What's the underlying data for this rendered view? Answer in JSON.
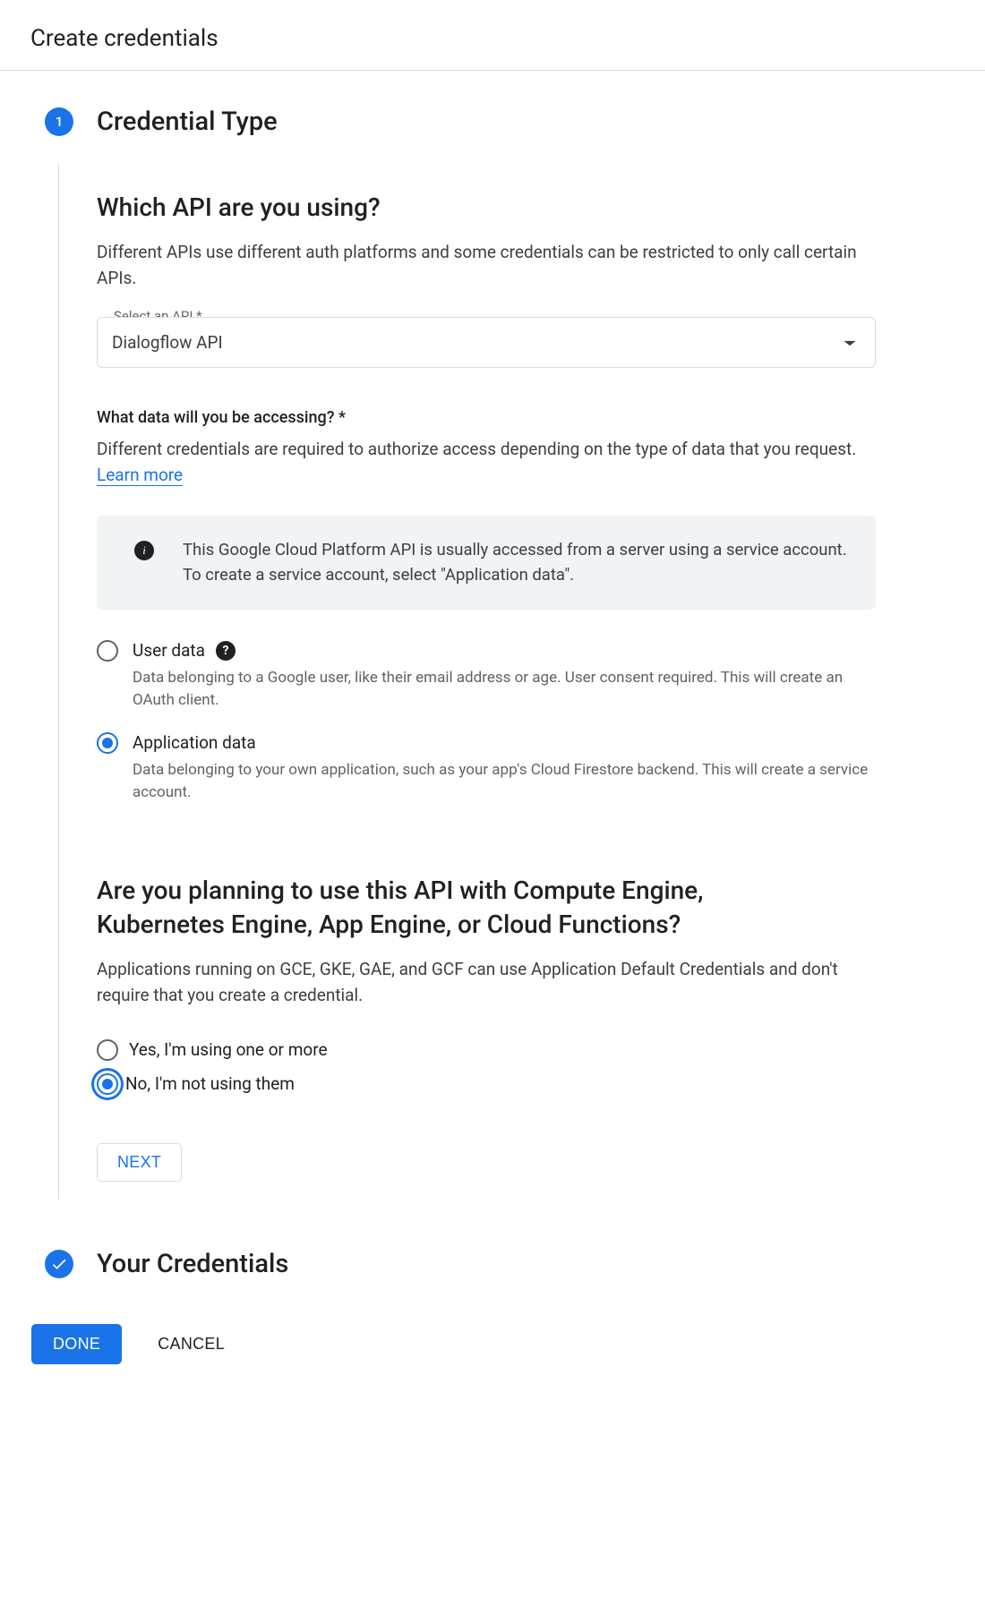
{
  "header": {
    "title": "Create credentials"
  },
  "step1": {
    "number": "1",
    "title": "Credential Type",
    "q1": {
      "heading": "Which API are you using?",
      "sub": "Different APIs use different auth platforms and some credentials can be restricted to only call certain APIs.",
      "select_label": "Select an API *",
      "select_value": "Dialogflow API"
    },
    "q2": {
      "label": "What data will you be accessing? *",
      "sub_prefix": "Different credentials are required to authorize access depending on the type of data that you request. ",
      "learn_more": "Learn more",
      "info": "This Google Cloud Platform API is usually accessed from a server using a service account. To create a service account, select \"Application data\".",
      "options": [
        {
          "title": "User data",
          "desc": "Data belonging to a Google user, like their email address or age. User consent required. This will create an OAuth client.",
          "checked": false,
          "help": true
        },
        {
          "title": "Application data",
          "desc": "Data belonging to your own application, such as your app's Cloud Firestore backend. This will create a service account.",
          "checked": true,
          "help": false
        }
      ]
    },
    "q3": {
      "heading": "Are you planning to use this API with Compute Engine, Kubernetes Engine, App Engine, or Cloud Functions?",
      "sub": "Applications running on GCE, GKE, GAE, and GCF can use Application Default Credentials and don't require that you create a credential.",
      "options": [
        {
          "label": "Yes, I'm using one or more",
          "checked": false
        },
        {
          "label": "No, I'm not using them",
          "checked": true,
          "focus_ring": true
        }
      ]
    },
    "next_label": "NEXT"
  },
  "step2": {
    "title": "Your Credentials"
  },
  "actions": {
    "done": "DONE",
    "cancel": "CANCEL"
  }
}
